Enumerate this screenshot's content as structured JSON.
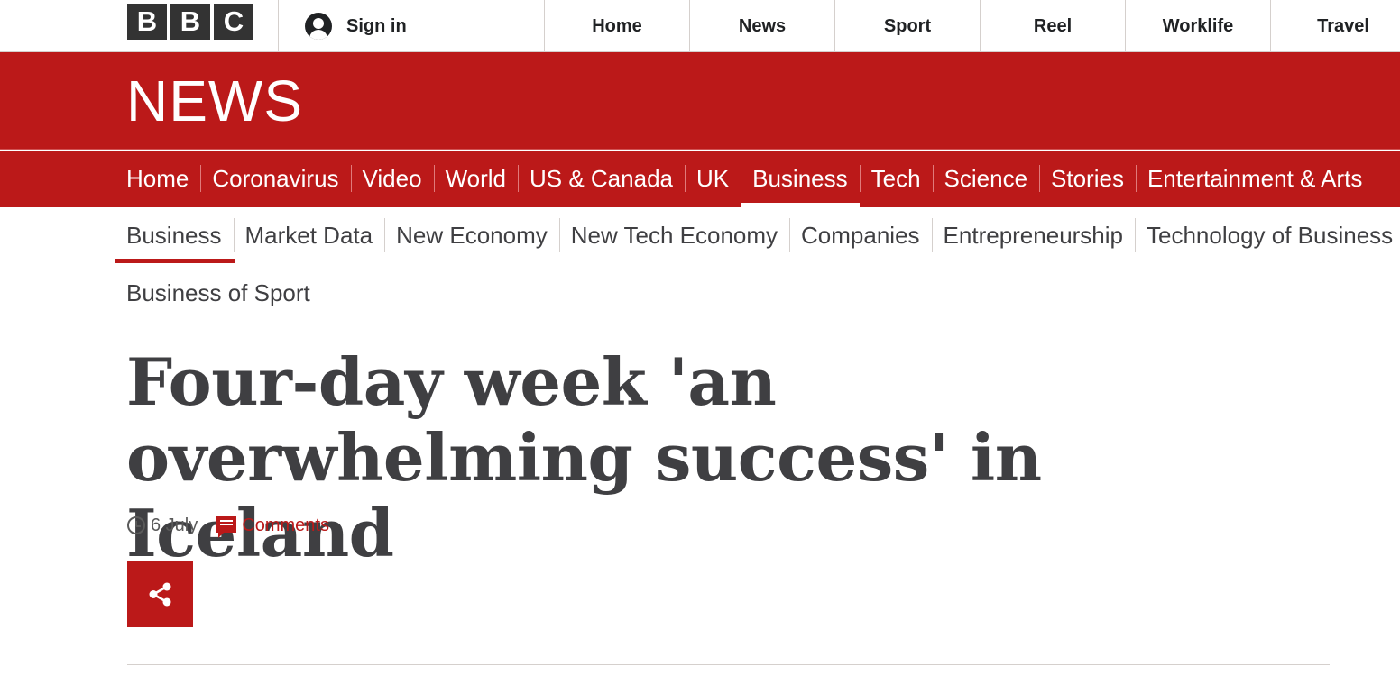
{
  "brand": {
    "logo_letters": [
      "B",
      "B",
      "C"
    ],
    "news_wordmark": "NEWS",
    "accent_color": "#bb1919"
  },
  "account": {
    "signin_label": "Sign in",
    "icon": "user-icon"
  },
  "top_nav": {
    "items": [
      {
        "label": "Home"
      },
      {
        "label": "News"
      },
      {
        "label": "Sport"
      },
      {
        "label": "Reel"
      },
      {
        "label": "Worklife"
      },
      {
        "label": "Travel"
      }
    ]
  },
  "section_nav": {
    "items": [
      {
        "label": "Home"
      },
      {
        "label": "Coronavirus"
      },
      {
        "label": "Video"
      },
      {
        "label": "World"
      },
      {
        "label": "US & Canada"
      },
      {
        "label": "UK"
      },
      {
        "label": "Business"
      },
      {
        "label": "Tech"
      },
      {
        "label": "Science"
      },
      {
        "label": "Stories"
      },
      {
        "label": "Entertainment & Arts"
      }
    ],
    "active": "Business"
  },
  "sub_nav": {
    "items": [
      {
        "label": "Business"
      },
      {
        "label": "Market Data"
      },
      {
        "label": "New Economy"
      },
      {
        "label": "New Tech Economy"
      },
      {
        "label": "Companies"
      },
      {
        "label": "Entrepreneurship"
      },
      {
        "label": "Technology of Business"
      },
      {
        "label": "Business of Sport"
      }
    ],
    "active": "Business"
  },
  "article": {
    "headline": "Four-day week 'an overwhelming success' in Iceland",
    "date": "6 July",
    "comments_label": "Comments",
    "clock_icon": "clock-icon",
    "comment_icon": "comment-icon",
    "share_icon": "share-icon"
  }
}
